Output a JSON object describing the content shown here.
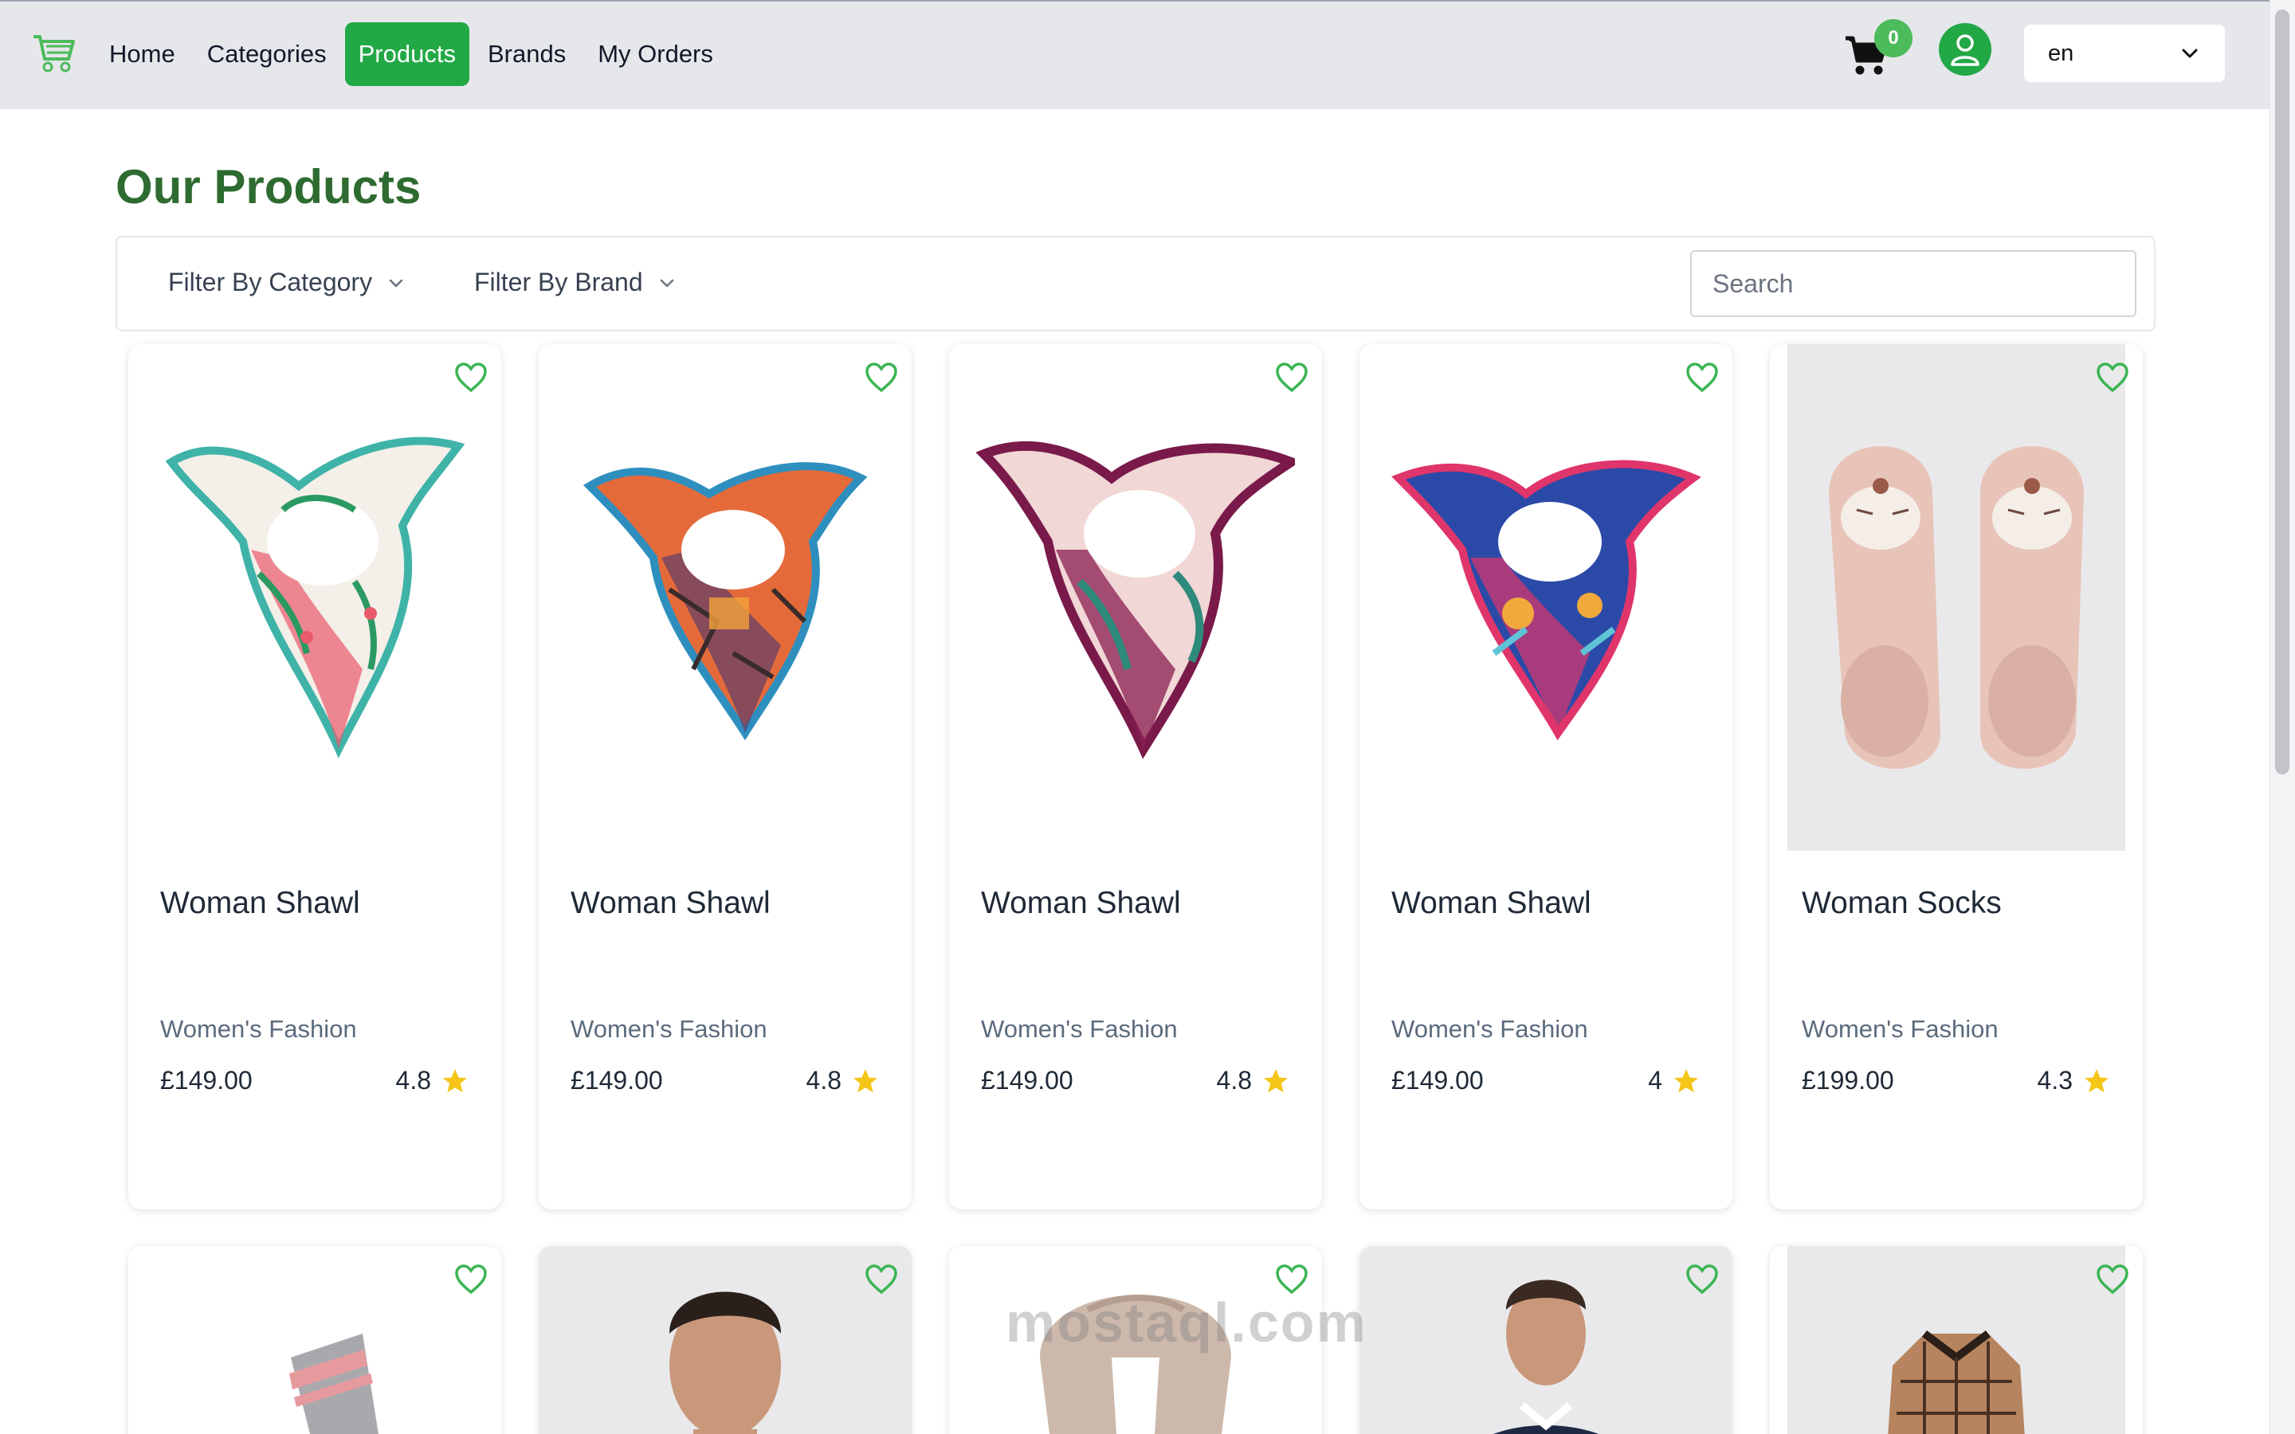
{
  "navbar": {
    "links": [
      {
        "label": "Home",
        "active": false
      },
      {
        "label": "Categories",
        "active": false
      },
      {
        "label": "Products",
        "active": true
      },
      {
        "label": "Brands",
        "active": false
      },
      {
        "label": "My Orders",
        "active": false
      }
    ],
    "cart_count": "0",
    "language": "en",
    "icons": {
      "logo": "cart-logo-icon",
      "cart": "shopping-cart-icon",
      "user": "user-icon",
      "chevron": "chevron-down-icon"
    }
  },
  "page": {
    "title": "Our Products"
  },
  "filters": {
    "category_label": "Filter By Category",
    "brand_label": "Filter By Brand",
    "search_placeholder": "Search"
  },
  "products": [
    {
      "name": "Woman Shawl",
      "category": "Women's Fashion",
      "price": "£149.00",
      "rating": "4.8",
      "image": "shawl-mint"
    },
    {
      "name": "Woman Shawl",
      "category": "Women's Fashion",
      "price": "£149.00",
      "rating": "4.8",
      "image": "shawl-orange"
    },
    {
      "name": "Woman Shawl",
      "category": "Women's Fashion",
      "price": "£149.00",
      "rating": "4.8",
      "image": "shawl-plum"
    },
    {
      "name": "Woman Shawl",
      "category": "Women's Fashion",
      "price": "£149.00",
      "rating": "4",
      "image": "shawl-navy"
    },
    {
      "name": "Woman Socks",
      "category": "Women's Fashion",
      "price": "£199.00",
      "rating": "4.3",
      "image": "socks-pink"
    }
  ],
  "products_row2": [
    {
      "image": "sock-gray"
    },
    {
      "image": "man-portrait"
    },
    {
      "image": "scarf-beige"
    },
    {
      "image": "man-sweater"
    },
    {
      "image": "shirt-check"
    }
  ],
  "watermark": "mostaql.com",
  "colors": {
    "accent": "#22a845",
    "title": "#2e6b30",
    "heart": "#3cb554",
    "star": "#f5c518"
  }
}
